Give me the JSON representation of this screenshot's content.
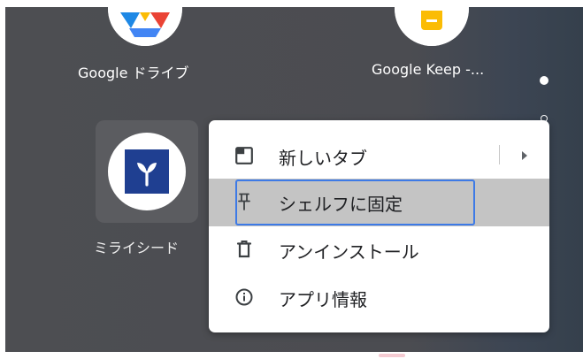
{
  "apps": [
    {
      "label": "Google ドライブ",
      "icon": "google-drive-icon"
    },
    {
      "label": "Google Keep -...",
      "icon": "google-keep-icon"
    },
    {
      "label": "ミライシード",
      "icon": "miraiseed-sprout-icon"
    }
  ],
  "context_menu": {
    "items": [
      {
        "label": "新しいタブ",
        "icon": "open-tab-icon",
        "has_submenu": true
      },
      {
        "label": "シェルフに固定",
        "icon": "pin-icon",
        "highlighted": true
      },
      {
        "label": "アンインストール",
        "icon": "trash-icon"
      },
      {
        "label": "アプリ情報",
        "icon": "info-icon"
      }
    ]
  },
  "colors": {
    "launcher_background": "#4b4c51",
    "menu_background": "#ffffff",
    "highlight": "#c4c4c4",
    "focus_ring": "#3d7ae6",
    "miraiseed_blue": "#1f3f91"
  }
}
